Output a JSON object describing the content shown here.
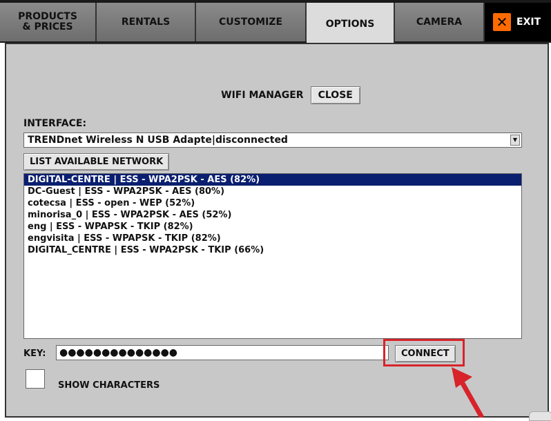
{
  "tabs": [
    {
      "label": "PRODUCTS\n& PRICES",
      "active": false
    },
    {
      "label": "RENTALS",
      "active": false
    },
    {
      "label": "CUSTOMIZE",
      "active": false
    },
    {
      "label": "OPTIONS",
      "active": true
    },
    {
      "label": "CAMERA",
      "active": false
    }
  ],
  "exit": {
    "icon": "close-icon",
    "label": "EXIT"
  },
  "wifi": {
    "title": "WIFI MANAGER",
    "close_label": "CLOSE",
    "interface_label": "INTERFACE:",
    "interface_value": "TRENDnet Wireless N USB Adapte|disconnected",
    "list_button": "LIST AVAILABLE NETWORK",
    "networks": [
      "DIGITAL-CENTRE | ESS - WPA2PSK - AES (82%)",
      "DC-Guest | ESS - WPA2PSK - AES (80%)",
      "cotecsa | ESS - open - WEP (52%)",
      "minorisa_0 | ESS - WPA2PSK - AES (52%)",
      "eng | ESS - WPAPSK - TKIP (82%)",
      "engvisita | ESS - WPAPSK - TKIP (82%)",
      "DIGITAL_CENTRE | ESS - WPA2PSK - TKIP (66%)"
    ],
    "selected_network": "DIGITAL-CENTRE | ESS - WPA2PSK - AES (82%)",
    "key_label": "KEY:",
    "key_value": "●●●●●●●●●●●●●●",
    "connect_label": "CONNECT",
    "show_characters_label": "SHOW CHARACTERS"
  },
  "colors": {
    "selection": "#0a1f70",
    "highlight": "#d8232a",
    "exit_accent": "#ff6a00"
  }
}
